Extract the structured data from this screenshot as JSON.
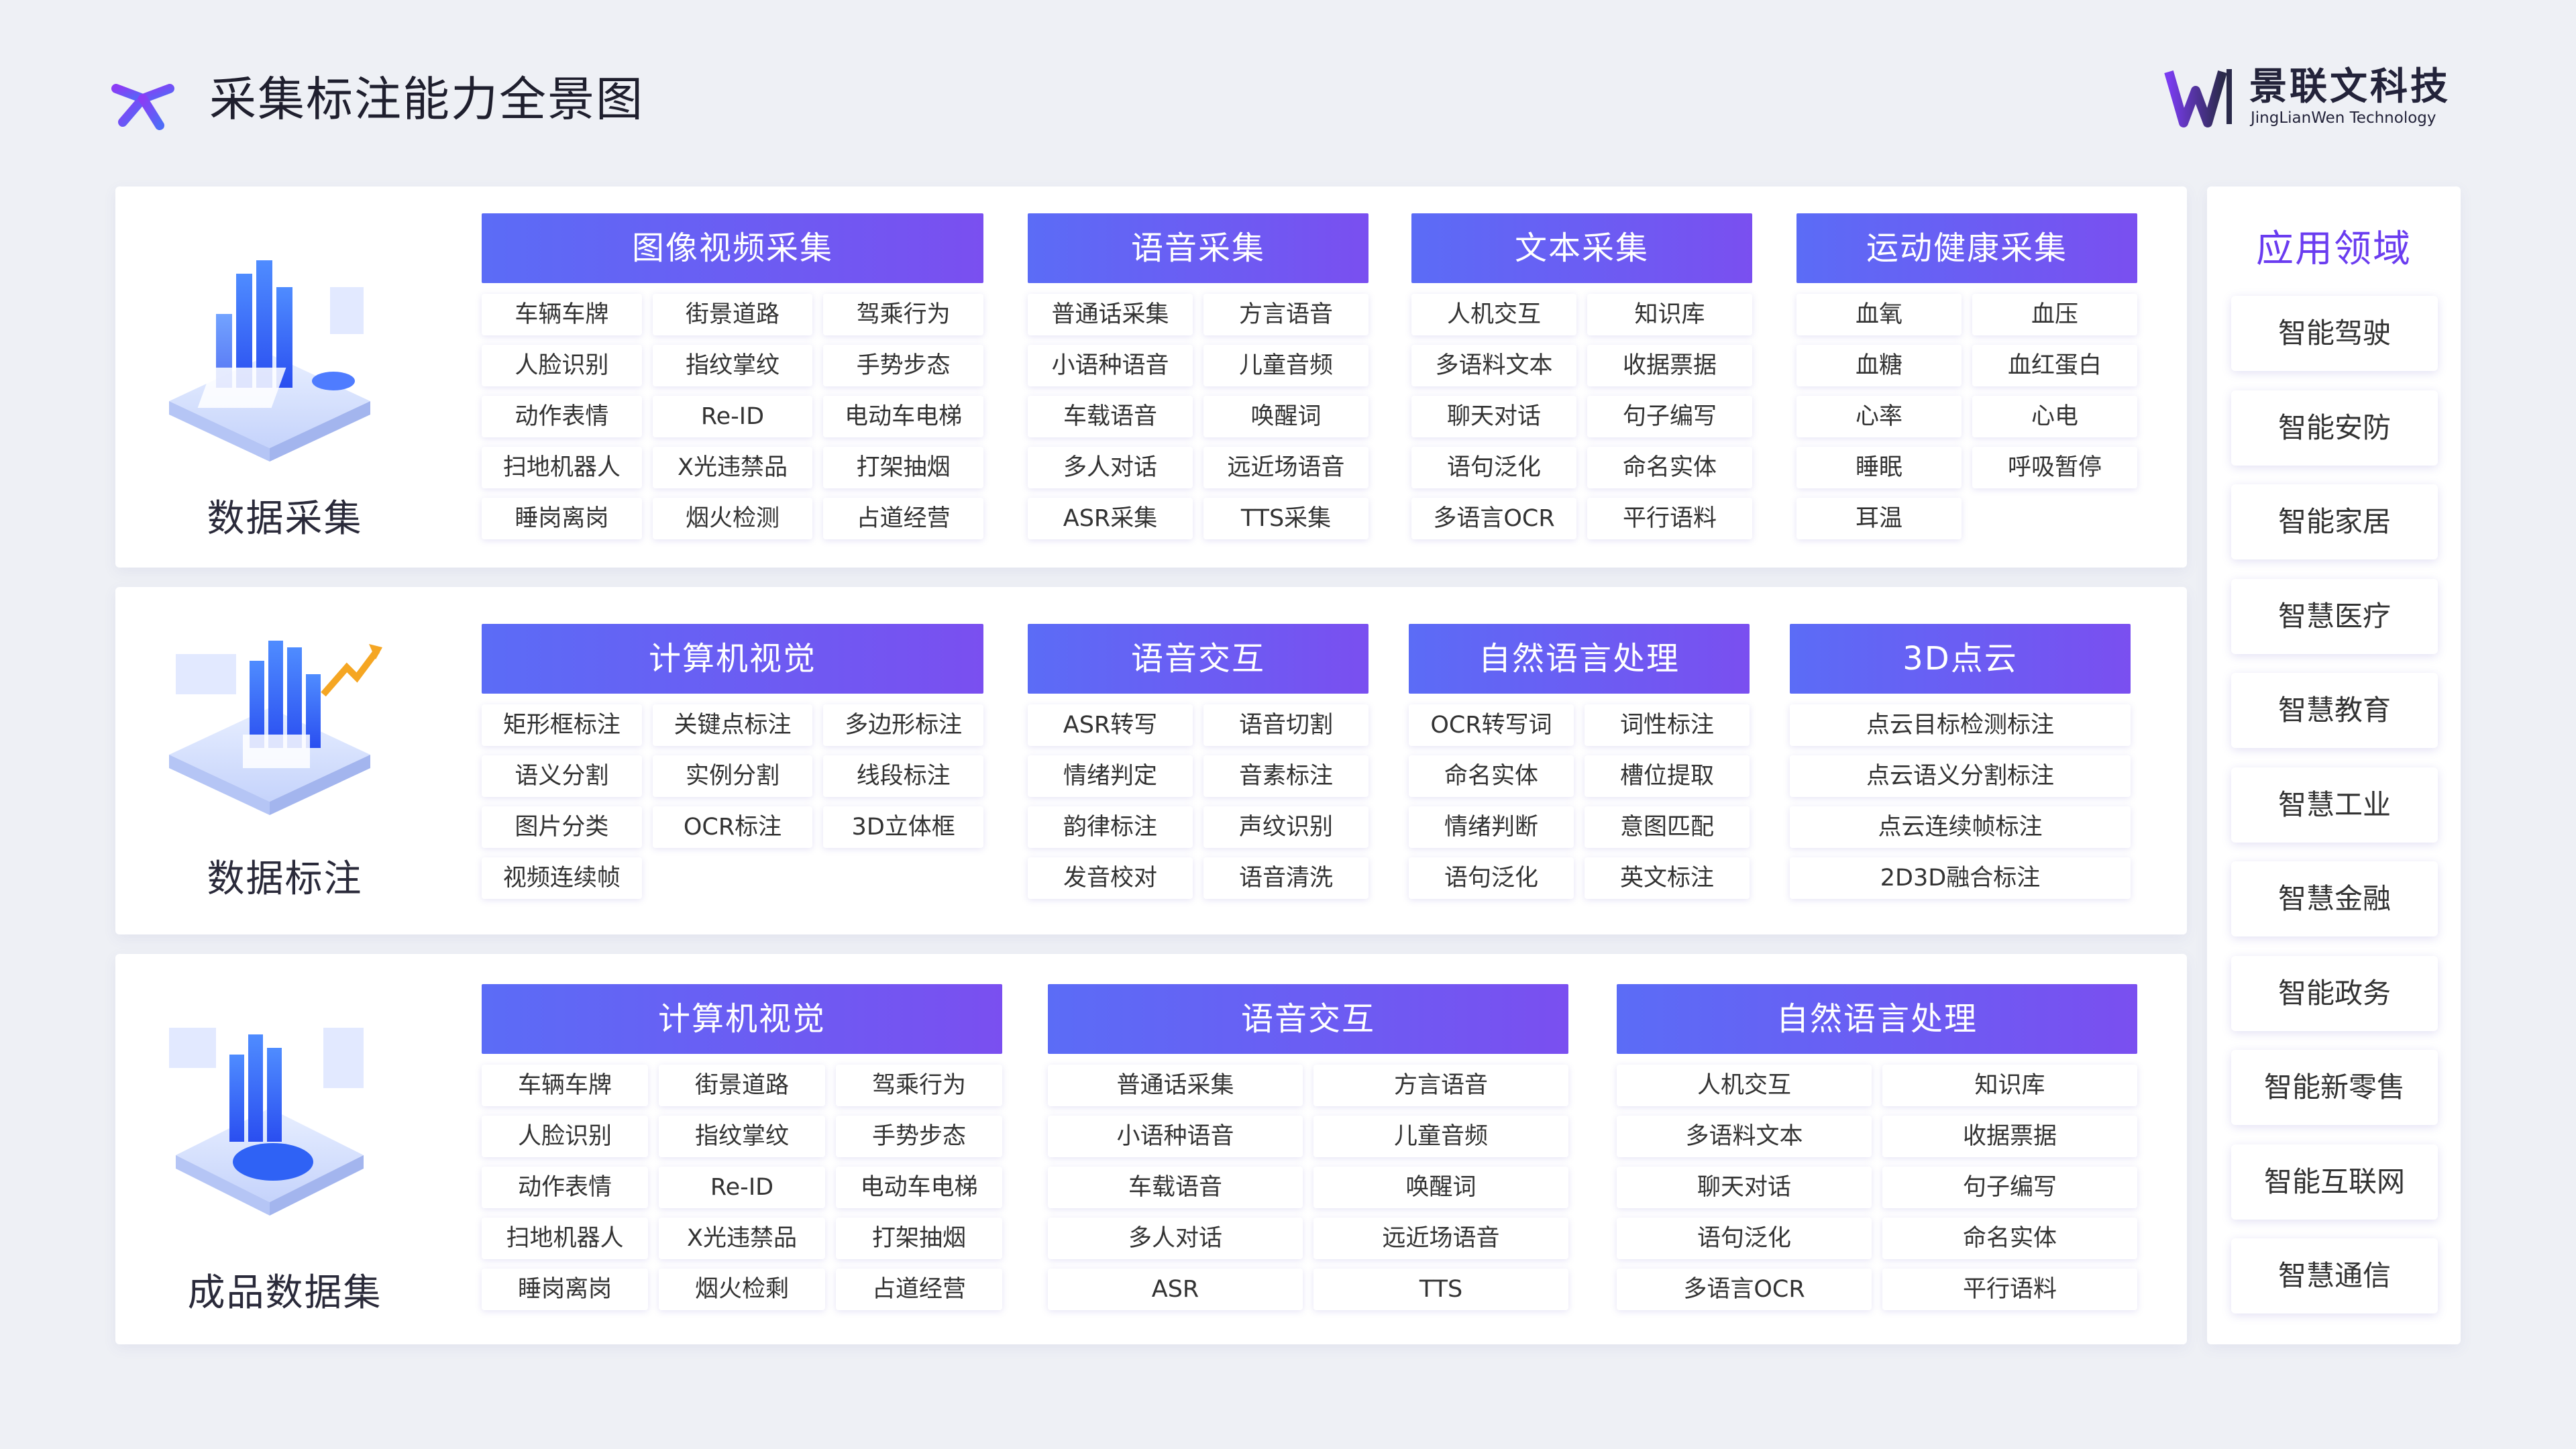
{
  "header": {
    "title": "采集标注能力全景图",
    "brand_cn": "景联文科技",
    "brand_en": "JingLianWen Technology"
  },
  "colors": {
    "accent_start": "#5b6cf6",
    "accent_end": "#7a4ff0",
    "app_title": "#6a3cf0"
  },
  "sections": [
    {
      "label": "数据采集",
      "categories": [
        {
          "title": "图像视频采集",
          "items": [
            "车辆车牌",
            "街景道路",
            "驾乘行为",
            "人脸识别",
            "指纹掌纹",
            "手势步态",
            "动作表情",
            "Re-ID",
            "电动车电梯",
            "扫地机器人",
            "X光违禁品",
            "打架抽烟",
            "睡岗离岗",
            "烟火检测",
            "占道经营"
          ]
        },
        {
          "title": "语音采集",
          "items": [
            "普通话采集",
            "方言语音",
            "小语种语音",
            "儿童音频",
            "车载语音",
            "唤醒词",
            "多人对话",
            "远近场语音",
            "ASR采集",
            "TTS采集"
          ]
        },
        {
          "title": "文本采集",
          "items": [
            "人机交互",
            "知识库",
            "多语料文本",
            "收据票据",
            "聊天对话",
            "句子编写",
            "语句泛化",
            "命名实体",
            "多语言OCR",
            "平行语料"
          ]
        },
        {
          "title": "运动健康采集",
          "items": [
            "血氧",
            "血压",
            "血糖",
            "血红蛋白",
            "心率",
            "心电",
            "睡眠",
            "呼吸暂停",
            "耳温"
          ]
        }
      ]
    },
    {
      "label": "数据标注",
      "categories": [
        {
          "title": "计算机视觉",
          "items": [
            "矩形框标注",
            "关键点标注",
            "多边形标注",
            "语义分割",
            "实例分割",
            "线段标注",
            "图片分类",
            "OCR标注",
            "3D立体框",
            "视频连续帧"
          ]
        },
        {
          "title": "语音交互",
          "items": [
            "ASR转写",
            "语音切割",
            "情绪判定",
            "音素标注",
            "韵律标注",
            "声纹识别",
            "发音校对",
            "语音清洗"
          ]
        },
        {
          "title": "自然语言处理",
          "items": [
            "OCR转写词",
            "词性标注",
            "命名实体",
            "槽位提取",
            "情绪判断",
            "意图匹配",
            "语句泛化",
            "英文标注"
          ]
        },
        {
          "title": "3D点云",
          "items": [
            "点云目标检测标注",
            "点云语义分割标注",
            "点云连续帧标注",
            "2D3D融合标注"
          ]
        }
      ]
    },
    {
      "label": "成品数据集",
      "categories": [
        {
          "title": "计算机视觉",
          "items": [
            "车辆车牌",
            "街景道路",
            "驾乘行为",
            "人脸识别",
            "指纹掌纹",
            "手势步态",
            "动作表情",
            "Re-ID",
            "电动车电梯",
            "扫地机器人",
            "X光违禁品",
            "打架抽烟",
            "睡岗离岗",
            "烟火检剩",
            "占道经营"
          ]
        },
        {
          "title": "语音交互",
          "items": [
            "普通话采集",
            "方言语音",
            "小语种语音",
            "儿童音频",
            "车载语音",
            "唤醒词",
            "多人对话",
            "远近场语音",
            "ASR",
            "TTS"
          ]
        },
        {
          "title": "自然语言处理",
          "items": [
            "人机交互",
            "知识库",
            "多语料文本",
            "收据票据",
            "聊天对话",
            "句子编写",
            "语句泛化",
            "命名实体",
            "多语言OCR",
            "平行语料"
          ]
        }
      ]
    }
  ],
  "apps": {
    "title": "应用领域",
    "items": [
      "智能驾驶",
      "智能安防",
      "智能家居",
      "智慧医疗",
      "智慧教育",
      "智慧工业",
      "智慧金融",
      "智能政务",
      "智能新零售",
      "智能互联网",
      "智慧通信"
    ]
  }
}
